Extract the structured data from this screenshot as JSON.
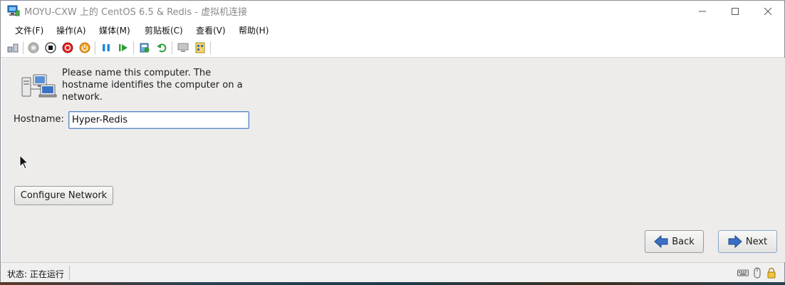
{
  "window": {
    "title": "MOYU-CXW 上的 CentOS 6.5 & Redis - 虚拟机连接",
    "controls": {
      "minimize": "—",
      "maximize": "☐",
      "close": "✕"
    }
  },
  "menubar": {
    "items": [
      "文件(F)",
      "操作(A)",
      "媒体(M)",
      "剪贴板(C)",
      "查看(V)",
      "帮助(H)"
    ]
  },
  "toolbar": {
    "buttons": [
      "ctrl-alt-del-icon",
      "start-icon",
      "turn-off-icon",
      "shut-down-icon",
      "power-icon",
      "pause-icon",
      "resume-icon",
      "checkpoint-icon",
      "revert-icon",
      "enhanced-session-icon",
      "share-icon"
    ]
  },
  "installer": {
    "prompt": "Please name this computer.  The\nhostname identifies the computer on a\nnetwork.",
    "hostname_label": "Hostname:",
    "hostname_value": "Hyper-Redis",
    "configure_network_label": "Configure Network",
    "back_label": "Back",
    "next_label": "Next"
  },
  "statusbar": {
    "status": "状态: 正在运行",
    "icons": [
      "keyboard-icon",
      "mouse-icon",
      "lock-icon"
    ]
  },
  "colors": {
    "guest_background": "#edeceb",
    "input_border": "#5a8ac4"
  }
}
